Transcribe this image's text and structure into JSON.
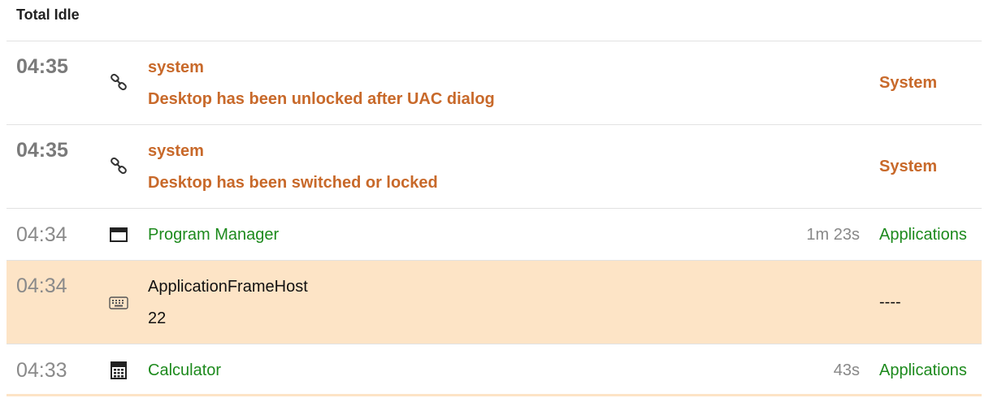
{
  "header": {
    "title": "Total Idle"
  },
  "rows": [
    {
      "time": "04:35",
      "icon": "link-icon",
      "line1": "system",
      "line2": "Desktop has been unlocked after UAC dialog",
      "duration": "",
      "category": "System"
    },
    {
      "time": "04:35",
      "icon": "link-icon",
      "line1": "system",
      "line2": "Desktop has been switched or locked",
      "duration": "",
      "category": "System"
    },
    {
      "time": "04:34",
      "icon": "window-icon",
      "line1": "Program Manager",
      "line2": "",
      "duration": "1m 23s",
      "category": "Applications"
    },
    {
      "time": "04:34",
      "icon": "keyboard-icon",
      "line1": "ApplicationFrameHost",
      "line2": "22",
      "duration": "",
      "category": "----"
    },
    {
      "time": "04:33",
      "icon": "calculator-icon",
      "line1": "Calculator",
      "line2": "",
      "duration": "43s",
      "category": "Applications"
    }
  ],
  "colors": {
    "system": "#c8692a",
    "applications": "#1d8a1d",
    "highlight": "#fde4c6"
  }
}
